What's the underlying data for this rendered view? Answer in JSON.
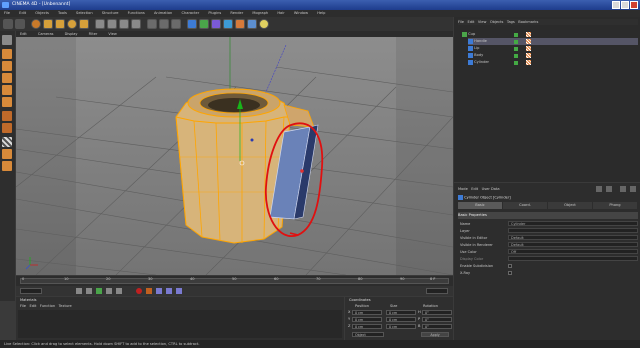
{
  "app": {
    "title": "CINEMA 4D - [Unbenannt]"
  },
  "menubar": {
    "items": [
      "File",
      "Edit",
      "Objects",
      "Tools",
      "Selection",
      "Structure",
      "Functions",
      "Animation",
      "Character",
      "Plugins",
      "Render",
      "Mograph",
      "Hair",
      "Window",
      "Help"
    ]
  },
  "viewport": {
    "menu": [
      "Edit",
      "Cameras",
      "Display",
      "Filter",
      "View"
    ]
  },
  "object_manager": {
    "menu": [
      "File",
      "Edit",
      "View",
      "Objects",
      "Tags",
      "Bookmarks"
    ],
    "rows": [
      {
        "name": "Cup"
      },
      {
        "name": "Handle"
      },
      {
        "name": "Lip"
      },
      {
        "name": "Body"
      },
      {
        "name": "Cylinder"
      }
    ]
  },
  "attributes": {
    "menu": [
      "Mode",
      "Edit",
      "User Data"
    ],
    "object_label": "Cylinder Object [Cylinder]",
    "tabs": [
      "Basic",
      "Coord.",
      "Object",
      "Phong"
    ],
    "section": "Basic Properties",
    "rows": [
      {
        "label": "Name",
        "value": "Cylinder"
      },
      {
        "label": "Layer",
        "value": ""
      },
      {
        "label": "Visible in Editor",
        "value": "Default"
      },
      {
        "label": "Visible in Renderer",
        "value": "Default"
      },
      {
        "label": "Use Color",
        "value": "Off"
      },
      {
        "label": "Display Color",
        "value": ""
      },
      {
        "label": "Enable Subdivision",
        "value": ""
      },
      {
        "label": "X-Ray",
        "value": ""
      }
    ]
  },
  "materials": {
    "title": "Materials",
    "menu": [
      "File",
      "Edit",
      "Function",
      "Texture"
    ]
  },
  "coordinates": {
    "title": "Coordinates",
    "headers": [
      "Position",
      "Size",
      "Rotation"
    ],
    "rows": [
      {
        "axis": "X",
        "pos": "0 cm",
        "size": "0 cm",
        "rot_label": "H",
        "rot": "0°"
      },
      {
        "axis": "Y",
        "pos": "0 cm",
        "size": "0 cm",
        "rot_label": "P",
        "rot": "0°"
      },
      {
        "axis": "Z",
        "pos": "0 cm",
        "size": "0 cm",
        "rot_label": "B",
        "rot": "0°"
      }
    ],
    "mode": "Object",
    "apply_label": "Apply"
  },
  "timeline": {
    "ticks": [
      "0",
      "10",
      "20",
      "30",
      "40",
      "50",
      "60",
      "70",
      "80",
      "90"
    ],
    "frame": "0 F"
  },
  "status": {
    "text": "Live Selection: Click and drag to select elements. Hold down SHIFT to add to the selection, CTRL to subtract."
  },
  "colors": {
    "cup_fill": "#d7b47a",
    "cup_edge": "#ffa500",
    "annotation": "#e01010",
    "viewport_bg": "#808080"
  }
}
